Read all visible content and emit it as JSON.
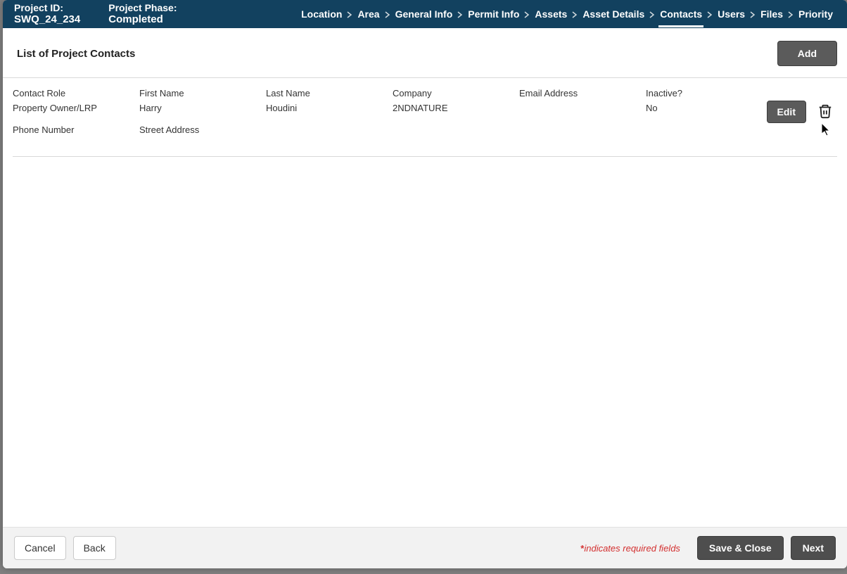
{
  "header": {
    "project_id_label": "Project ID:",
    "project_id_value": "SWQ_24_234",
    "project_phase_label": "Project Phase:",
    "project_phase_value": "Completed",
    "crumbs": [
      "Location",
      "Area",
      "General Info",
      "Permit Info",
      "Assets",
      "Asset Details",
      "Contacts",
      "Users",
      "Files",
      "Priority"
    ],
    "active_crumb_index": 6
  },
  "section": {
    "title": "List of Project Contacts",
    "add_label": "Add"
  },
  "labels": {
    "contact_role": "Contact Role",
    "first_name": "First Name",
    "last_name": "Last Name",
    "company": "Company",
    "email": "Email Address",
    "inactive": "Inactive?",
    "phone": "Phone Number",
    "street": "Street Address",
    "edit": "Edit"
  },
  "contacts": [
    {
      "role": "Property Owner/LRP",
      "first_name": "Harry",
      "last_name": "Houdini",
      "company": "2NDNATURE",
      "email": "",
      "inactive": "No",
      "phone": "",
      "street": ""
    }
  ],
  "footer": {
    "cancel": "Cancel",
    "back": "Back",
    "required_note": "indicates required fields",
    "save_close": "Save & Close",
    "next": "Next"
  }
}
